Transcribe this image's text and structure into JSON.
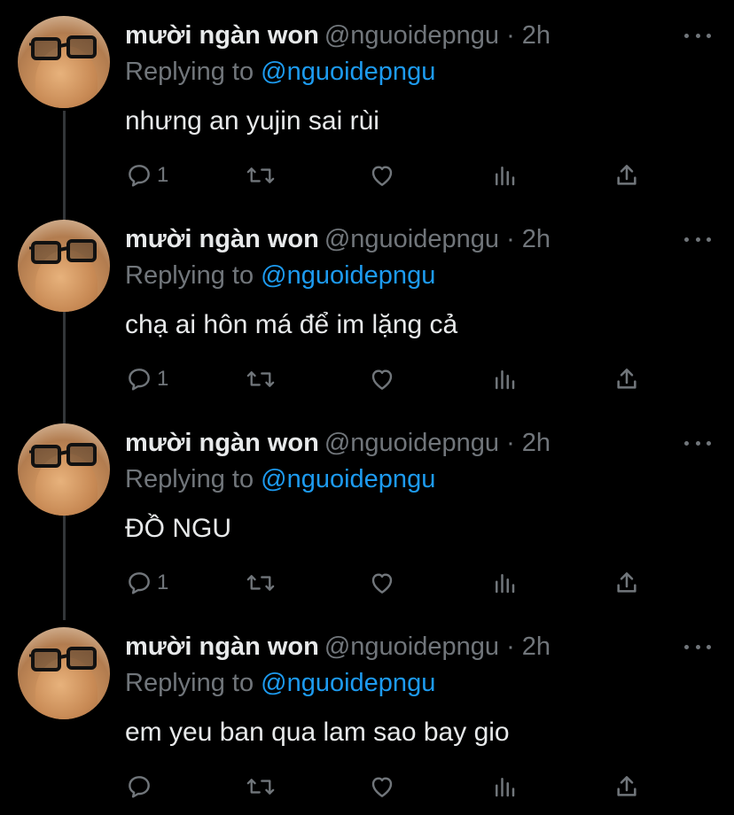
{
  "colors": {
    "background": "#000000",
    "text": "#e7e9ea",
    "secondary": "#71767b",
    "accent": "#1d9bf0",
    "thread_line": "#333639"
  },
  "tweets": [
    {
      "name": "mười ngàn won",
      "handle": "@nguoidepngu · 2h",
      "replying_prefix": "Replying to",
      "replying_to": "@nguoidepngu",
      "text": "nhưng an yujin sai rùi",
      "reply_count": "1",
      "icons": [
        "reply-icon",
        "retweet-icon",
        "like-icon",
        "views-icon",
        "share-icon",
        "more-icon"
      ]
    },
    {
      "name": "mười ngàn won",
      "handle": "@nguoidepngu · 2h",
      "replying_prefix": "Replying to",
      "replying_to": "@nguoidepngu",
      "text": "chạ ai hôn má để im lặng cả",
      "reply_count": "1",
      "icons": [
        "reply-icon",
        "retweet-icon",
        "like-icon",
        "views-icon",
        "share-icon",
        "more-icon"
      ]
    },
    {
      "name": "mười ngàn won",
      "handle": "@nguoidepngu · 2h",
      "replying_prefix": "Replying to",
      "replying_to": "@nguoidepngu",
      "text": "ĐỒ NGU",
      "reply_count": "1",
      "icons": [
        "reply-icon",
        "retweet-icon",
        "like-icon",
        "views-icon",
        "share-icon",
        "more-icon"
      ]
    },
    {
      "name": "mười ngàn won",
      "handle": "@nguoidepngu · 2h",
      "replying_prefix": "Replying to",
      "replying_to": "@nguoidepngu",
      "text": "em yeu ban qua lam sao bay gio",
      "reply_count": "",
      "icons": [
        "reply-icon",
        "retweet-icon",
        "like-icon",
        "views-icon",
        "share-icon",
        "more-icon"
      ]
    }
  ]
}
